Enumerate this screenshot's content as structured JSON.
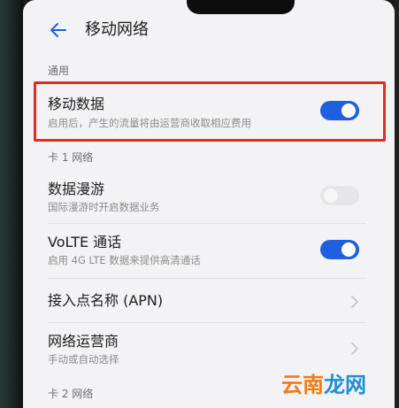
{
  "header": {
    "title": "移动网络"
  },
  "sections": {
    "general": "通用",
    "sim1": "卡 1 网络",
    "sim2": "卡 2 网络"
  },
  "rows": {
    "mobile_data": {
      "title": "移动数据",
      "subtitle": "启用后，产生的流量将由运营商收取相应费用",
      "toggle": "on"
    },
    "roaming": {
      "title": "数据漫游",
      "subtitle": "国际漫游时开启数据业务",
      "toggle": "off"
    },
    "volte": {
      "title": "VoLTE 通话",
      "subtitle": "启用 4G LTE 数据来提供高清通话",
      "toggle": "on"
    },
    "apn": {
      "title": "接入点名称 (APN)"
    },
    "operator": {
      "title": "网络运营商",
      "subtitle": "手动或自动选择"
    }
  },
  "watermark": {
    "part1": "云南",
    "part2": "龙网"
  },
  "colors": {
    "accent": "#1f5fe0",
    "highlight": "#e12a2a"
  }
}
